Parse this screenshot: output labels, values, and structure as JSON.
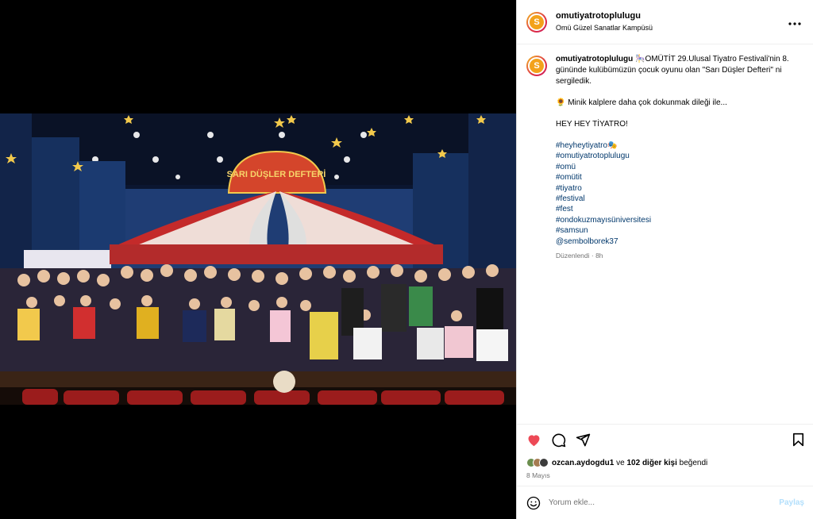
{
  "post": {
    "username": "omutiyatrotoplulugu",
    "location": "Omü Güzel Sanatlar Kampüsü",
    "avatar_text": "S",
    "more_icon": "more-horizontal-icon"
  },
  "photo": {
    "banner_text": "SARI DÜŞLER DEFTERİ",
    "colors": {
      "stage_bg": "#0e1c3a",
      "curtain": "#1c2f5a",
      "banner": "#d4452b",
      "star": "#f2c94c",
      "drape_red": "#c42a2a",
      "drape_white": "#f4f1ea",
      "floor": "#3a2416",
      "seats": "#9b1c1c"
    }
  },
  "caption": {
    "username": "omutiyatrotoplulugu",
    "line1": "🎠OMÜTİT 29.Ulusal Tiyatro Festivali'nin 8. gününde kulübümüzün çocuk oyunu olan \"Sarı Düşler Defteri\" ni sergiledik.",
    "line2": "🌻 Minik kalplere daha çok dokunmak dileği ile...",
    "line3": "HEY HEY TİYATRO!",
    "hashtags": [
      "#heyheytiyatro🎭",
      "#omutiyatrotoplulugu",
      "#omü",
      "#omütit",
      "#tiyatro",
      "#festival",
      "#fest",
      "#ondokuzmayısüniversitesi",
      "#samsun",
      "@sembolborek37"
    ],
    "edited": "Düzenlendi · 8h"
  },
  "actions": {
    "like_icon": "heart-filled-icon",
    "comment_icon": "comment-icon",
    "share_icon": "share-icon",
    "save_icon": "bookmark-icon",
    "like_color": "#ed4956"
  },
  "likes": {
    "user": "ozcan.aydogdu1",
    "connector": " ve ",
    "others": "102 diğer kişi",
    "suffix": " beğendi"
  },
  "date": "8 Mayıs",
  "comment": {
    "placeholder": "Yorum ekle...",
    "post_label": "Paylaş",
    "emoji_icon": "emoji-icon"
  }
}
